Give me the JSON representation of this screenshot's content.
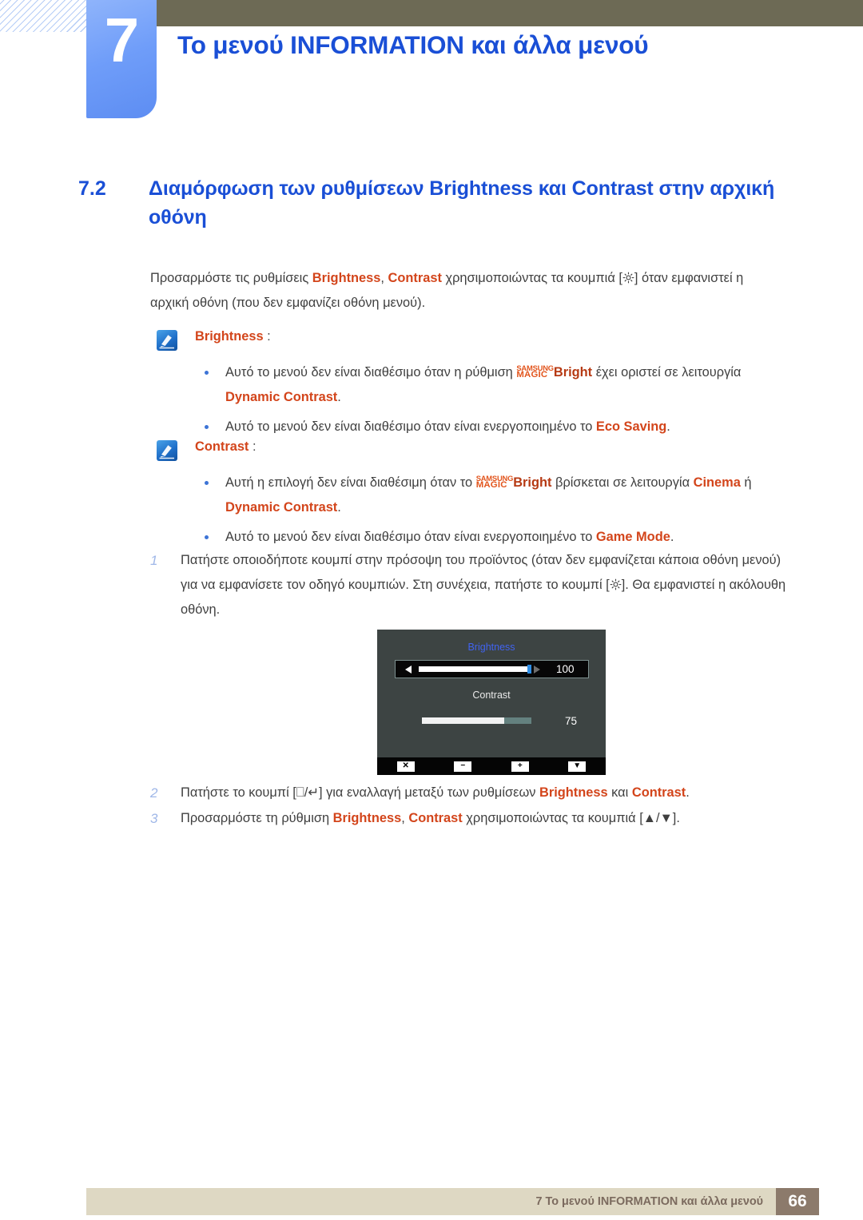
{
  "chapter": {
    "number": "7",
    "title": "Το μενού INFORMATION και άλλα μενού"
  },
  "section": {
    "number": "7.2",
    "title_line1": "Διαμόρφωση των ρυθμίσεων Brightness και Contrast",
    "title_line2": "στην αρχική οθόνη"
  },
  "intro": {
    "t1": "Προσαρμόστε τις ρυθμίσεις ",
    "b1": "Brightness",
    "t2": ", ",
    "b2": "Contrast",
    "t3": " χρησιμοποιώντας τα κουμπιά [",
    "t4": "] όταν εμφανιστεί η αρχική οθόνη (που δεν εμφανίζει οθόνη μενού)."
  },
  "notes": [
    {
      "icon": "note-pen-icon",
      "title": "Brightness",
      "colon": " :",
      "bullets": [
        {
          "t1": "Αυτό το μενού δεν είναι διαθέσιμο όταν η ρύθμιση ",
          "logo_top": "SAMSUNG",
          "logo_bottom": "MAGIC",
          "logo_word": "Bright",
          "t2": " έχει οριστεί σε λειτουργία ",
          "b1": "Dynamic Contrast",
          "t3": "."
        },
        {
          "t1": "Αυτό το μενού δεν είναι διαθέσιμο όταν είναι ενεργοποιημένο το ",
          "b1": "Eco Saving",
          "t3": "."
        }
      ]
    },
    {
      "icon": "note-pen-icon",
      "title": "Contrast",
      "colon": " :",
      "bullets": [
        {
          "t1": "Αυτή η επιλογή δεν είναι διαθέσιμη όταν το ",
          "logo_top": "SAMSUNG",
          "logo_bottom": "MAGIC",
          "logo_word": "Bright",
          "t2": " βρίσκεται σε λειτουργία ",
          "b1": "Cinema",
          "t2b": " ή ",
          "b2": "Dynamic Contrast",
          "t3": "."
        },
        {
          "t1": "Αυτό το μενού δεν είναι διαθέσιμο όταν είναι ενεργοποιημένο το ",
          "b1": "Game Mode",
          "t3": "."
        }
      ]
    }
  ],
  "steps": [
    {
      "num": "1",
      "t1": "Πατήστε οποιοδήποτε κουμπί στην πρόσοψη του προϊόντος (όταν δεν εμφανίζεται κάποια οθόνη μενού) για να εμφανίσετε τον οδηγό κουμπιών. Στη συνέχεια, πατήστε το κουμπί [",
      "t2": "]. Θα εμφανιστεί η ακόλουθη οθόνη."
    },
    {
      "num": "2",
      "t1": "Πατήστε το κουμπί [",
      "key1": "⎕",
      "keysep": "/",
      "key2": "↵",
      "t2": "] για εναλλαγή μεταξύ των ρυθμίσεων ",
      "b1": "Brightness",
      "t3": " και ",
      "b2": "Contrast",
      "t4": "."
    },
    {
      "num": "3",
      "t1": "Προσαρμόστε τη ρύθμιση ",
      "b1": "Brightness",
      "t2": ", ",
      "b2": "Contrast",
      "t3": " χρησιμοποιώντας τα κουμπιά [",
      "key1": "▲",
      "keysep": "/",
      "key2": "▼",
      "t4": "]."
    }
  ],
  "osd": {
    "brightness_label": "Brightness",
    "brightness_value": "100",
    "brightness_percent": 100,
    "contrast_label": "Contrast",
    "contrast_value": "75",
    "contrast_percent": 75,
    "buttons": [
      {
        "name": "close-button",
        "glyph": "✕"
      },
      {
        "name": "decrease-button",
        "glyph": "−"
      },
      {
        "name": "increase-button",
        "glyph": "+"
      },
      {
        "name": "down-button",
        "glyph": "▼"
      }
    ],
    "accent_color": "#4063f0",
    "handle_color": "#2f8fe6",
    "background_color": "#3d4443"
  },
  "footer": {
    "text": "7 Το μενού INFORMATION και άλλα μενού",
    "page": "66"
  },
  "colors": {
    "heading_blue": "#1a4fd6",
    "highlight_orange": "#d3451b",
    "olive": "#6d6a55",
    "footer_beige": "#ded8c3",
    "footer_brown": "#8c7a6b"
  }
}
